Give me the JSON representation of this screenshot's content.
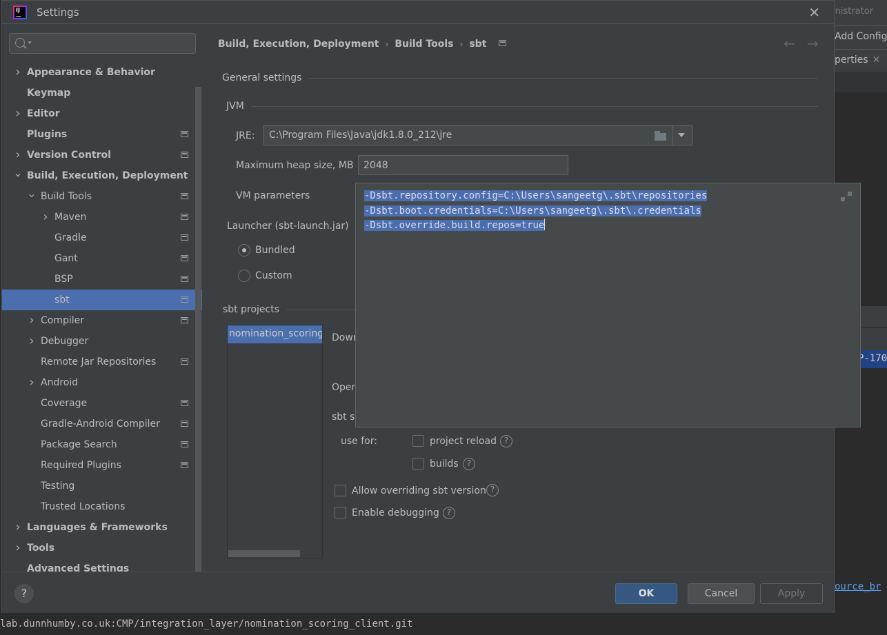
{
  "window": {
    "title": "Settings"
  },
  "background": {
    "admin_text": "inistrator",
    "add_config": "Add Config",
    "properties_tab": "perties",
    "editor_selection": "P-170",
    "editor_link": "ource_br",
    "bottom_line": "lab.dunnhumby.co.uk:CMP/integration_layer/nomination_scoring_client.git"
  },
  "search": {
    "placeholder": "",
    "value": ""
  },
  "sidebar": {
    "items": [
      {
        "label": "Appearance & Behavior",
        "bold": true,
        "level": 0,
        "arrow": "right",
        "proj": false
      },
      {
        "label": "Keymap",
        "bold": true,
        "level": 0,
        "arrow": "",
        "proj": false
      },
      {
        "label": "Editor",
        "bold": true,
        "level": 0,
        "arrow": "right",
        "proj": false
      },
      {
        "label": "Plugins",
        "bold": true,
        "level": 0,
        "arrow": "",
        "proj": true
      },
      {
        "label": "Version Control",
        "bold": true,
        "level": 0,
        "arrow": "right",
        "proj": true
      },
      {
        "label": "Build, Execution, Deployment",
        "bold": true,
        "level": 0,
        "arrow": "down",
        "proj": false
      },
      {
        "label": "Build Tools",
        "bold": false,
        "level": 1,
        "arrow": "down",
        "proj": true
      },
      {
        "label": "Maven",
        "bold": false,
        "level": 2,
        "arrow": "right",
        "proj": true
      },
      {
        "label": "Gradle",
        "bold": false,
        "level": 2,
        "arrow": "",
        "proj": true
      },
      {
        "label": "Gant",
        "bold": false,
        "level": 2,
        "arrow": "",
        "proj": true
      },
      {
        "label": "BSP",
        "bold": false,
        "level": 2,
        "arrow": "",
        "proj": true
      },
      {
        "label": "sbt",
        "bold": false,
        "level": 2,
        "arrow": "",
        "proj": true,
        "selected": true
      },
      {
        "label": "Compiler",
        "bold": false,
        "level": 1,
        "arrow": "right",
        "proj": true
      },
      {
        "label": "Debugger",
        "bold": false,
        "level": 1,
        "arrow": "right",
        "proj": false
      },
      {
        "label": "Remote Jar Repositories",
        "bold": false,
        "level": 1,
        "arrow": "",
        "proj": true
      },
      {
        "label": "Android",
        "bold": false,
        "level": 1,
        "arrow": "right",
        "proj": false
      },
      {
        "label": "Coverage",
        "bold": false,
        "level": 1,
        "arrow": "",
        "proj": true
      },
      {
        "label": "Gradle-Android Compiler",
        "bold": false,
        "level": 1,
        "arrow": "",
        "proj": true
      },
      {
        "label": "Package Search",
        "bold": false,
        "level": 1,
        "arrow": "",
        "proj": true
      },
      {
        "label": "Required Plugins",
        "bold": false,
        "level": 1,
        "arrow": "",
        "proj": true
      },
      {
        "label": "Testing",
        "bold": false,
        "level": 1,
        "arrow": "",
        "proj": false
      },
      {
        "label": "Trusted Locations",
        "bold": false,
        "level": 1,
        "arrow": "",
        "proj": false
      },
      {
        "label": "Languages & Frameworks",
        "bold": true,
        "level": 0,
        "arrow": "right",
        "proj": false
      },
      {
        "label": "Tools",
        "bold": true,
        "level": 0,
        "arrow": "right",
        "proj": false
      },
      {
        "label": "Advanced Settings",
        "bold": true,
        "level": 0,
        "arrow": "",
        "proj": false
      }
    ]
  },
  "breadcrumb": {
    "parts": [
      "Build, Execution, Deployment",
      "Build Tools",
      "sbt"
    ],
    "separator": "›"
  },
  "nav": {
    "back": "←",
    "forward": "→"
  },
  "general": {
    "section": "General settings",
    "jvm_section": "JVM",
    "jre_label": "JRE:",
    "jre_value": "C:\\Program Files\\Java\\jdk1.8.0_212\\jre",
    "heap_label": "Maximum heap size, MB",
    "heap_value": "2048",
    "vm_label": "VM parameters",
    "vm_lines": [
      "-Dsbt.repository.config=C:\\Users\\sangeetg\\.sbt\\repositories",
      "-Dsbt.boot.credentials=C:\\Users\\sangeetg\\.sbt\\.credentials",
      "-Dsbt.override.build.repos=true"
    ],
    "launcher_section": "Launcher (sbt-launch.jar)",
    "radio_bundled": "Bundled",
    "radio_custom": "Custom",
    "launcher_selected": "Bundled"
  },
  "projects": {
    "section": "sbt projects",
    "list": [
      "nomination_scoring_"
    ],
    "download_label": "Down",
    "open_label": "Open",
    "shell_label": "sbt sh",
    "use_for_label": "use for:",
    "project_reload": {
      "label": "project reload",
      "checked": false
    },
    "builds": {
      "label": "builds",
      "checked": false
    },
    "allow_override": {
      "label": "Allow overriding sbt version",
      "checked": false
    },
    "enable_debugging": {
      "label": "Enable debugging",
      "checked": false
    }
  },
  "footer": {
    "help": "?",
    "ok": "OK",
    "cancel": "Cancel",
    "apply": "Apply"
  },
  "colors": {
    "accent": "#4b6eaf",
    "ok_button": "#365880",
    "panel_bg": "#3c3f41",
    "link": "#5c9ef0"
  }
}
